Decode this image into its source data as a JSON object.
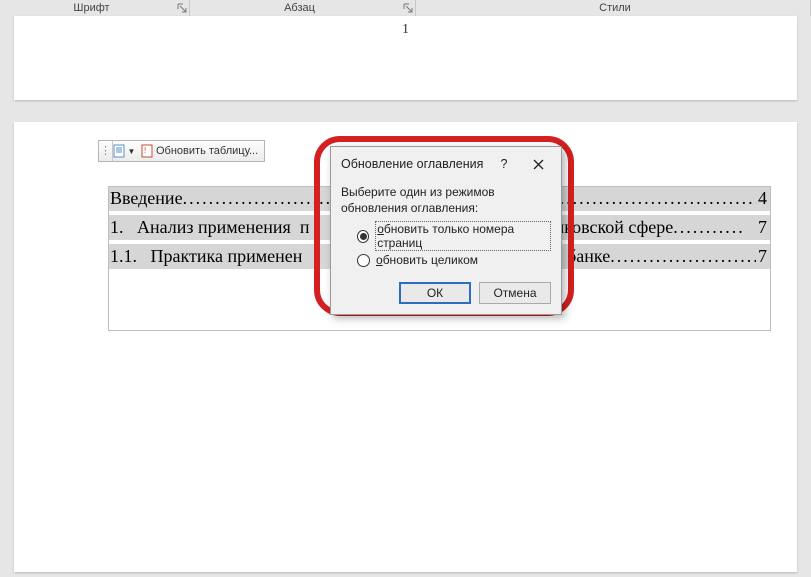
{
  "ribbon": {
    "font_group": "Шрифт",
    "para_group": "Абзац",
    "styles_group": "Стили"
  },
  "top_page": {
    "page_number": "1"
  },
  "toc_toolbar": {
    "update_label": "Обновить таблицу..."
  },
  "toc": {
    "lines": [
      {
        "left": "Введение",
        "page": "4"
      },
      {
        "left": "1.   Анализ применения  п",
        "right_fragment": "банковской сфере",
        "page": "7"
      },
      {
        "left": "1.1.   Практика применен",
        "right_fragment": "ий в банке",
        "page": "7"
      }
    ]
  },
  "dialog": {
    "title": "Обновление оглавления",
    "help": "?",
    "prompt": "Выберите один из режимов обновления оглавления:",
    "opt1_pre": "о",
    "opt1_rest": "бновить только номера страниц",
    "opt2_pre": "о",
    "opt2_rest": "бновить целиком",
    "ok": "ОК",
    "cancel": "Отмена"
  }
}
